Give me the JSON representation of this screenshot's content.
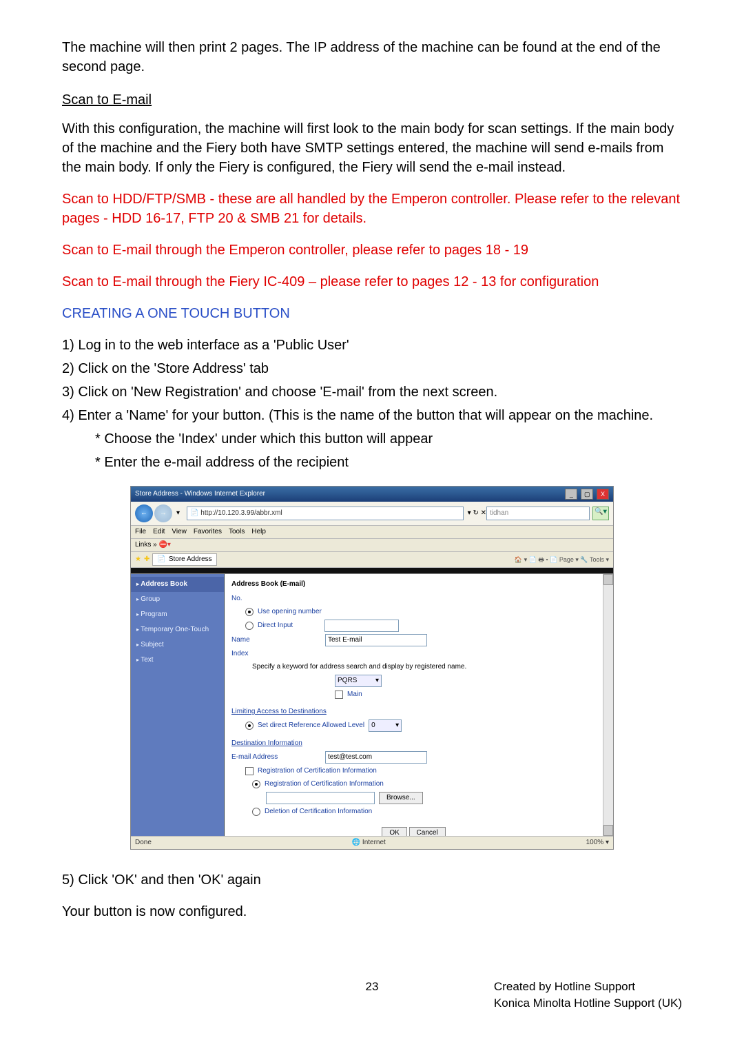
{
  "paragraphs": {
    "p1": "The machine will then print 2 pages.  The IP address of the machine can be found at the end of the second page.",
    "h1": "Scan to E-mail",
    "p2": "With this configuration, the machine will first look to the main body for scan settings. If the main body of the machine and the Fiery both have SMTP settings entered, the machine will send e-mails from the main body.  If only the Fiery is configured, the Fiery will send the e-mail instead.",
    "r1": "Scan to HDD/FTP/SMB - these are all handled by the Emperon controller. Please refer to the relevant pages - HDD 16-17, FTP 20 & SMB 21 for details.",
    "r2": "Scan to E-mail through the Emperon controller, please refer to pages 18 - 19",
    "r3": "Scan to E-mail through the Fiery IC-409 – please refer to pages 12 - 13 for configuration",
    "b1": "CREATING A ONE TOUCH BUTTON",
    "s1": "1) Log in to the web interface as a 'Public User'",
    "s2": "2) Click on the 'Store Address' tab",
    "s3": "3) Click on 'New Registration' and choose 'E-mail' from the next screen.",
    "s4": "4) Enter a 'Name' for your button.  (This is the name of the button that will appear on the machine.",
    "s4a": "* Choose the 'Index' under which this button will appear",
    "s4b": "* Enter the e-mail address of the recipient",
    "p5": "5) Click 'OK' and then 'OK' again",
    "p6": "Your button is now configured."
  },
  "shot": {
    "title": "Store Address - Windows Internet Explorer",
    "url": "http://10.120.3.99/abbr.xml",
    "search_placeholder": "tidhan",
    "tab_label": "Store Address",
    "toolbar_right": "🏠 ▾  📄   🖶 ▾  📄 Page ▾  🔧 Tools ▾",
    "menu": [
      "File",
      "Edit",
      "View",
      "Favorites",
      "Tools",
      "Help"
    ],
    "links_label": "Links »",
    "sidebar": [
      "Address Book",
      "Group",
      "Program",
      "Temporary One-Touch",
      "Subject",
      "Text"
    ],
    "form": {
      "header": "Address Book (E-mail)",
      "no_label": "No.",
      "use_opening": "Use opening number",
      "direct_input": "Direct Input",
      "name_label": "Name",
      "name_value": "Test E-mail",
      "index_label": "Index",
      "index_note": "Specify a keyword for address search and display by registered name.",
      "index_sel": "PQRS",
      "main_label": "Main",
      "limit_hdr": "Limiting Access to Destinations",
      "limit_row": "Set direct Reference Allowed Level",
      "limit_sel": "0",
      "dest_hdr": "Destination Information",
      "email_label": "E-mail Address",
      "email_value": "test@test.com",
      "reg_cert": "Registration of Certification Information",
      "reg_cert2": "Registration of Certification Information",
      "browse": "Browse...",
      "del_cert": "Deletion of Certification Information",
      "ok": "OK",
      "cancel": "Cancel"
    },
    "status_left": "Done",
    "status_mid": "Internet",
    "status_right": "100%  ▾"
  },
  "footer": {
    "page_number": "23",
    "line1": "Created by Hotline Support",
    "line2": "Konica Minolta Hotline Support (UK)"
  }
}
